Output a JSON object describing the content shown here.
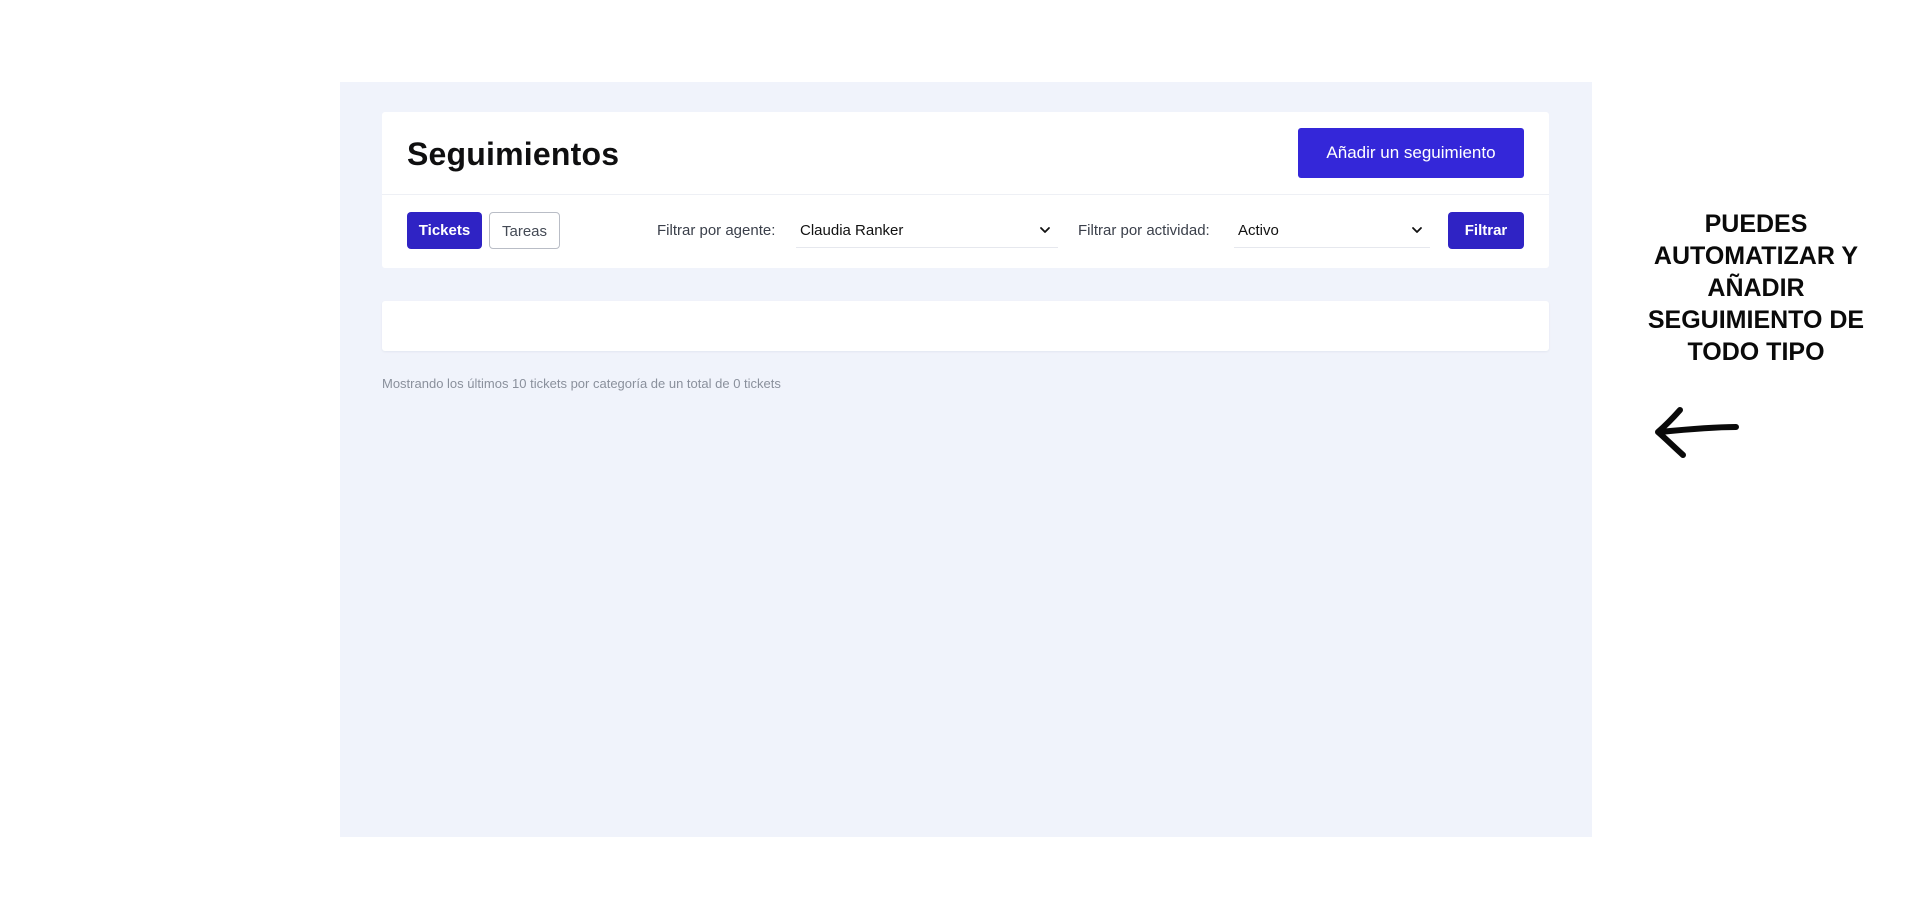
{
  "header": {
    "title": "Seguimientos",
    "add_button_label": "Añadir un seguimiento"
  },
  "tabs": [
    {
      "label": "Tickets",
      "active": true
    },
    {
      "label": "Tareas",
      "active": false
    }
  ],
  "filters": {
    "agent_label": "Filtrar por agente:",
    "agent_value": "Claudia Ranker",
    "activity_label": "Filtrar por actividad:",
    "activity_value": "Activo",
    "filter_button_label": "Filtrar"
  },
  "results": {
    "summary": "Mostrando los últimos 10 tickets por categoría de un total de 0 tickets"
  },
  "promo": {
    "text": "PUEDES AUTOMATIZAR Y AÑADIR SEGUIMIENTO DE TODO TIPO",
    "arrow_icon": "arrow-left-icon"
  },
  "colors": {
    "primary": "#3427d9",
    "primary_dark": "#2f23c4",
    "app_background": "#f0f3fb"
  }
}
